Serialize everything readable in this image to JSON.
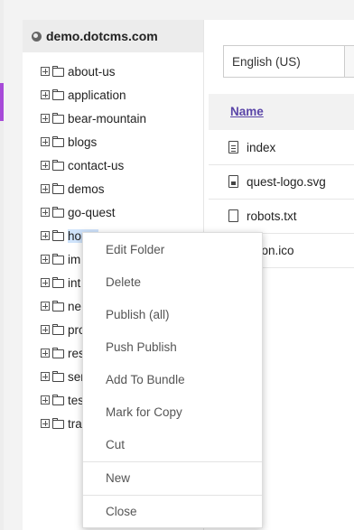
{
  "site": {
    "name": "demo.dotcms.com"
  },
  "tree": {
    "items": [
      {
        "label": "about-us"
      },
      {
        "label": "application"
      },
      {
        "label": "bear-mountain"
      },
      {
        "label": "blogs"
      },
      {
        "label": "contact-us"
      },
      {
        "label": "demos"
      },
      {
        "label": "go-quest"
      },
      {
        "label": "home"
      },
      {
        "label": "im"
      },
      {
        "label": "int"
      },
      {
        "label": "ne"
      },
      {
        "label": "pro"
      },
      {
        "label": "res"
      },
      {
        "label": "ser"
      },
      {
        "label": "tes"
      },
      {
        "label": "tra"
      }
    ]
  },
  "main": {
    "language": "English (US)",
    "name_header": "Name",
    "files": [
      {
        "name": "index",
        "icon": "document-icon"
      },
      {
        "name": "quest-logo.svg",
        "icon": "image-icon"
      },
      {
        "name": "robots.txt",
        "icon": "file-icon"
      },
      {
        "name": "vicon.ico",
        "icon": "file-icon"
      }
    ]
  },
  "context_menu": {
    "items": [
      {
        "label": "Edit Folder"
      },
      {
        "label": "Delete"
      },
      {
        "label": "Publish (all)"
      },
      {
        "label": "Push Publish"
      },
      {
        "label": "Add To Bundle"
      },
      {
        "label": "Mark for Copy"
      },
      {
        "label": "Cut"
      },
      {
        "label": "New"
      },
      {
        "label": "Close"
      }
    ]
  },
  "colors": {
    "accent": "#a74ad8",
    "link": "#5a45a8",
    "selection": "#cfe3fb"
  }
}
